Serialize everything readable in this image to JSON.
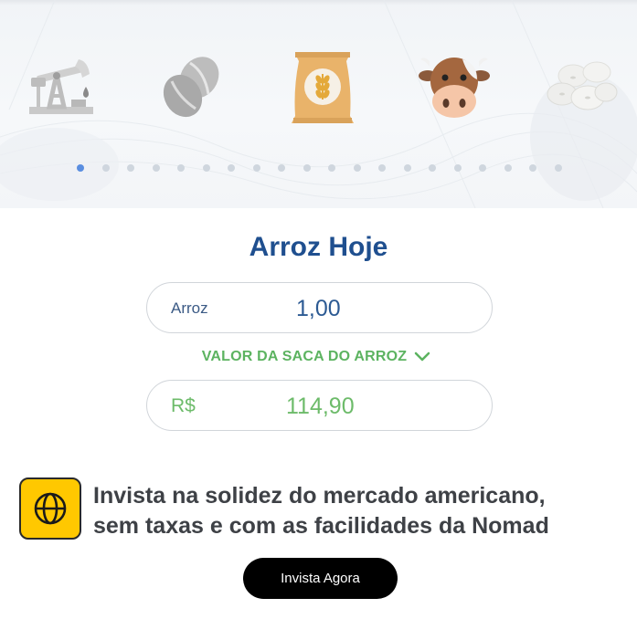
{
  "carousel": {
    "items": [
      {
        "icon": "oil-pump-icon"
      },
      {
        "icon": "coffee-beans-icon"
      },
      {
        "icon": "grain-sack-icon"
      },
      {
        "icon": "cow-icon"
      },
      {
        "icon": "white-beans-icon"
      }
    ],
    "dot_count": 20,
    "active_index": 0,
    "active_dot_color": "#5a8ee0"
  },
  "converter": {
    "title": "Arroz Hoje",
    "quantity_label": "Arroz",
    "quantity_value": "1,00",
    "unit_selector_label": "VALOR DA SACA DO ARROZ",
    "price_label": "R$",
    "price_value": "114,90"
  },
  "promo": {
    "icon": "globe-icon",
    "line1": "Invista na solidez do mercado americano,",
    "line2": "sem taxas e com as facilidades da Nomad",
    "button_label": "Invista Agora"
  },
  "colors": {
    "title_blue": "#1f4f8f",
    "green": "#5cb360",
    "promo_yellow": "#ffc800",
    "button_black": "#000000"
  }
}
